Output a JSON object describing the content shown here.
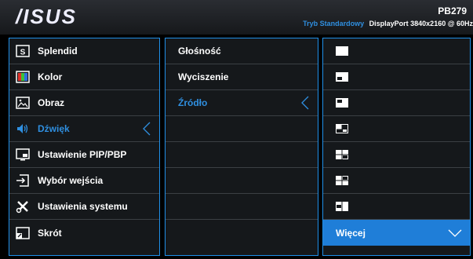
{
  "header": {
    "logo": "/ISUS",
    "model": "PB279",
    "mode": "Tryb Standardowy",
    "info": "DisplayPort  3840x2160 @ 60Hz"
  },
  "main_menu": [
    {
      "label": "Splendid",
      "icon": "splendid-icon"
    },
    {
      "label": "Kolor",
      "icon": "color-icon"
    },
    {
      "label": "Obraz",
      "icon": "image-icon"
    },
    {
      "label": "Dźwięk",
      "icon": "speaker-icon",
      "selected": true
    },
    {
      "label": "Ustawienie PIP/PBP",
      "icon": "pip-icon"
    },
    {
      "label": "Wybór wejścia",
      "icon": "input-icon"
    },
    {
      "label": "Ustawienia systemu",
      "icon": "wrench-icon"
    },
    {
      "label": "Skrót",
      "icon": "shortcut-icon"
    }
  ],
  "sub_menu": [
    {
      "label": "Głośność"
    },
    {
      "label": "Wyciszenie"
    },
    {
      "label": "Źródło",
      "selected": true
    }
  ],
  "options": {
    "more_label": "Więcej"
  },
  "colors": {
    "accent": "#1f8fe8",
    "selected_text": "#2f8fe0"
  }
}
